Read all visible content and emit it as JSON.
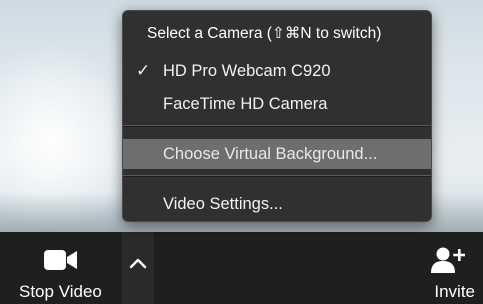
{
  "camera_menu": {
    "header": "Select a Camera (⇧⌘N to switch)",
    "items": [
      {
        "label": "HD Pro Webcam C920",
        "selected": true,
        "check_glyph": "✓"
      },
      {
        "label": "FaceTime HD Camera",
        "selected": false
      }
    ],
    "background_item": {
      "label": "Choose Virtual Background...",
      "highlighted": true
    },
    "settings_item": {
      "label": "Video Settings..."
    }
  },
  "toolbar": {
    "stop_video_label": "Stop Video",
    "invite_label": "Invite",
    "icons": {
      "video": "video-camera-icon",
      "caret": "chevron-up-icon",
      "invite": "add-user-icon"
    }
  },
  "colors": {
    "menu_bg": "#303030",
    "menu_highlight": "#6e6e6e",
    "toolbar_bg": "#1f1f1f",
    "text": "#ffffff"
  }
}
